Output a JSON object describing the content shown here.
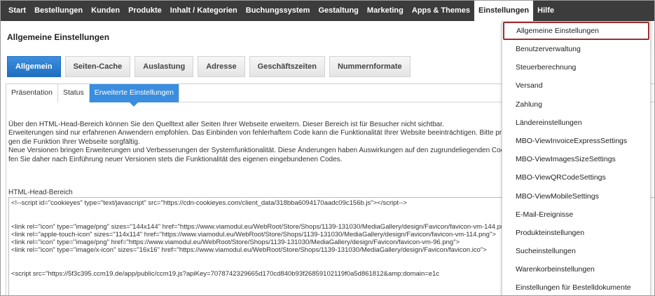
{
  "topnav": {
    "items": [
      {
        "label": "Start"
      },
      {
        "label": "Bestellungen"
      },
      {
        "label": "Kunden"
      },
      {
        "label": "Produkte"
      },
      {
        "label": "Inhalt / Kategorien"
      },
      {
        "label": "Buchungssystem"
      },
      {
        "label": "Gestaltung"
      },
      {
        "label": "Marketing"
      },
      {
        "label": "Apps & Themes"
      },
      {
        "label": "Einstellungen"
      },
      {
        "label": "Hilfe"
      }
    ],
    "active_index": 9
  },
  "page": {
    "title": "Allgemeine Einstellungen"
  },
  "main_tabs": [
    {
      "label": "Allgemein"
    },
    {
      "label": "Seiten-Cache"
    },
    {
      "label": "Auslastung"
    },
    {
      "label": "Adresse"
    },
    {
      "label": "Geschäftszeiten"
    },
    {
      "label": "Nummernformate"
    }
  ],
  "sub_tabs": [
    {
      "label": "Präsentation"
    },
    {
      "label": "Status"
    },
    {
      "label": "Erweiterte Einstellungen"
    }
  ],
  "description": {
    "lines": [
      "Über den HTML-Head-Bereich können Sie den Quelltext aller Seiten Ihrer Webseite erweitern. Dieser Bereich ist für Besucher nicht sichtbar.",
      "Erweiterungen sind nur erfahrenen Anwendern empfohlen. Das Einbinden von fehlerhaftem Code kann die Funktionalität Ihrer Website beeinträchtigen. Bitte prü",
      "gen die Funktion Ihrer Webseite sorgfältig.",
      "Neue Versionen bringen Erweiterungen und Verbesserungen der Systemfunktionalität. Diese Änderungen haben Auswirkungen auf den zugrundeliegenden Code. Bitte prü",
      "fen Sie daher nach Einführung neuer Versionen stets die Funktionalität des eigenen eingebundenen Codes."
    ]
  },
  "html_head": {
    "label": "HTML-Head-Bereich",
    "lines": [
      "<!--script id=\"cookieyes\" type=\"text/javascript\" src=\"https://cdn-cookieyes.com/client_data/318bba6094170aadc09c156b.js\"></script-->",
      "",
      "",
      "<link rel=\"icon\" type=\"image/png\" sizes=\"144x144\" href=\"https://www.viamodul.eu/WebRoot/Store/Shops/1139-131030/MediaGallery/design/Favicon/favicon-vm-144.png\">",
      "<link rel=\"apple-touch-icon\" sizes=\"114x114\" href=\"https://www.viamodul.eu/WebRoot/Store/Shops/1139-131030/MediaGallery/design/Favicon/favicon-vm-114.png\">",
      "<link rel=\"icon\" type=\"image/png\" href=\"https://www.viamodul.eu/WebRoot/Store/Shops/1139-131030/MediaGallery/design/Favicon/favicon-vm-96.png\">",
      "<link rel=\"icon\" type=\"image/x-icon\" sizes=\"16x16\" href=\"https://www.viamodul.eu/WebRoot/Store/Shops/1139-131030/MediaGallery/design/Favicon/favicon.ico\">",
      "",
      "",
      "<script src=\"https://5f3c395.ccm19.de/app/public/ccm19.js?apiKey=7078742329665d170cd840b93f26859102119f0a5d861812&amp;domain=e1c"
    ]
  },
  "dropdown": {
    "items": [
      {
        "label": "Allgemeine Einstellungen"
      },
      {
        "label": "Benutzerverwaltung"
      },
      {
        "label": "Steuerberechnung"
      },
      {
        "label": "Versand"
      },
      {
        "label": "Zahlung"
      },
      {
        "label": "Ländereinstellungen"
      },
      {
        "label": "MBO-ViewInvoiceExpressSettings"
      },
      {
        "label": "MBO-ViewImagesSizeSettings"
      },
      {
        "label": "MBO-ViewQRCodeSettings"
      },
      {
        "label": "MBO-ViewMobileSettings"
      },
      {
        "label": "E-Mail-Ereignisse"
      },
      {
        "label": "Produkteinstellungen"
      },
      {
        "label": "Sucheinstellungen"
      },
      {
        "label": "Warenkorbeinstellungen"
      },
      {
        "label": "Einstellungen für Bestelldokumente"
      }
    ],
    "selected_index": 0
  },
  "colors": {
    "nav_bg": "#3c3c3c",
    "accent_blue": "#2f80d4",
    "selected_border": "#9b2f2f"
  }
}
